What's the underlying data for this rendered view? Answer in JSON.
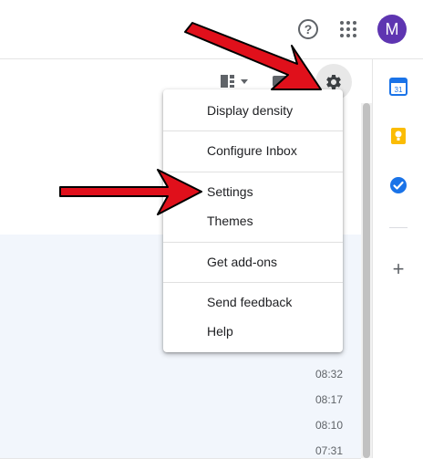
{
  "header": {
    "help_label": "?",
    "avatar_letter": "M",
    "avatar_color": "#5e35b1"
  },
  "icons": {
    "help": "help-circle-icon",
    "apps": "apps-grid-icon",
    "gear": "gear-icon",
    "split": "split-pane-icon",
    "input_tools": "keyboard-icon",
    "calendar": "calendar-icon",
    "keep": "keep-icon",
    "tasks": "tasks-icon",
    "add": "plus-icon"
  },
  "side_panel": {
    "calendar_day": "31",
    "add_label": "+"
  },
  "settings_menu": {
    "items": [
      {
        "label": "Display density"
      },
      {
        "label": "Configure Inbox"
      },
      {
        "label": "Settings"
      },
      {
        "label": "Themes"
      },
      {
        "label": "Get add-ons"
      },
      {
        "label": "Send feedback"
      },
      {
        "label": "Help"
      }
    ]
  },
  "mail_list": {
    "times": [
      "08:32",
      "08:17",
      "08:10",
      "07:31"
    ]
  },
  "colors": {
    "arrow_red": "#e0101b",
    "gear_bg": "#e8e8e8",
    "read_row_bg": "#f2f6fc"
  }
}
